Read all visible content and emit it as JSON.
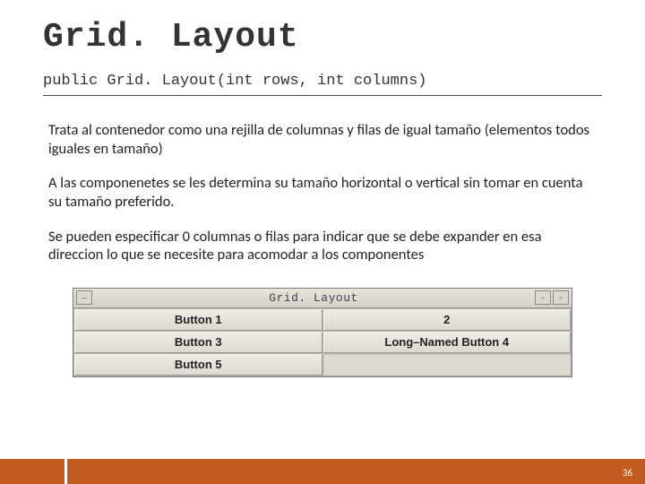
{
  "title": "Grid. Layout",
  "signature": "public Grid. Layout(int rows, int columns)",
  "paragraphs": {
    "p1": "Trata al contenedor como una rejilla de columnas y filas de igual tamaño (elementos todos iguales en tamaño)",
    "p2": "A las componenetes se les determina su tamaño horizontal o vertical sin tomar en cuenta su tamaño preferido.",
    "p3": "Se pueden especificar 0 columnas o filas para indicar que se debe expander en esa direccion lo que se necesite para acomodar a los componentes"
  },
  "window": {
    "title": "Grid. Layout",
    "minimize_glyph": "–",
    "restore_glyph": "▫",
    "close_glyph": "▫",
    "buttons": {
      "b1": "Button 1",
      "b2": "2",
      "b3": "Button 3",
      "b4": "Long–Named Button 4",
      "b5": "Button 5"
    }
  },
  "page_number": "36"
}
